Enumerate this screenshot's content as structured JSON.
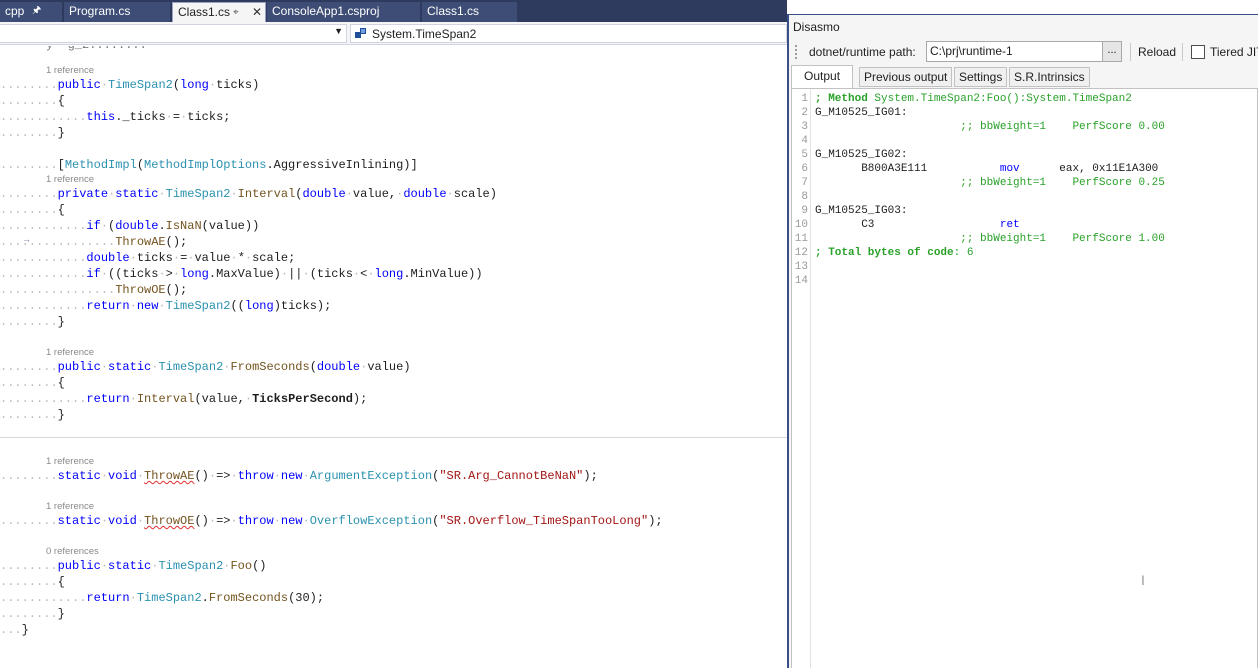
{
  "tabs": [
    {
      "label": "cpp",
      "pinned": true,
      "active": false
    },
    {
      "label": "Program.cs",
      "active": false
    },
    {
      "label": "Class1.cs",
      "pinned": true,
      "active": true,
      "close": "✕"
    },
    {
      "label": "ConsoleApp1.csproj",
      "active": false
    },
    {
      "label": "Class1.cs",
      "active": false
    }
  ],
  "navbar": {
    "left_value": "",
    "right_value": "System.TimeSpan2"
  },
  "editor": {
    "refs": {
      "r1": "1 reference",
      "r2": "1 reference",
      "r3": "1 reference",
      "r4": "1 reference",
      "r5": "1 reference",
      "r6": "0 references"
    },
    "code": {
      "l01a": "public",
      "l01b": "TimeSpan2",
      "l01c": "(",
      "l01d": "long",
      "l01e": "ticks",
      "l01f": ")",
      "l02": "{",
      "l03a": "this",
      "l03b": "._ticks",
      "l03c": "=",
      "l03d": "ticks;",
      "l04": "}",
      "l05a": "[",
      "l05b": "MethodImpl",
      "l05c": "(",
      "l05d": "MethodImplOptions",
      "l05e": ".AggressiveInlining)]",
      "l06a": "private",
      "l06b": "static",
      "l06c": "TimeSpan2",
      "l06d": "Interval",
      "l06e": "(",
      "l06f": "double",
      "l06g": "value,",
      "l06h": "double",
      "l06i": "scale)",
      "l07": "{",
      "l08a": "if",
      "l08b": "(",
      "l08c": "double",
      "l08d": ".",
      "l08e": "IsNaN",
      "l08f": "(value))",
      "l09a": "ThrowAE",
      "l09b": "();",
      "l10a": "double",
      "l10b": "ticks",
      "l10c": "=",
      "l10d": "value",
      "l10e": "*",
      "l10f": "scale;",
      "l11a": "if",
      "l11b": "((ticks",
      "l11c": ">",
      "l11d": "long",
      "l11e": ".MaxValue)",
      "l11f": "||",
      "l11g": "(ticks",
      "l11h": "<",
      "l11i": "long",
      "l11j": ".MinValue))",
      "l12a": "ThrowOE",
      "l12b": "();",
      "l13a": "return",
      "l13b": "new",
      "l13c": "TimeSpan2",
      "l13d": "((",
      "l13e": "long",
      "l13f": ")ticks);",
      "l14": "}",
      "l15a": "public",
      "l15b": "static",
      "l15c": "TimeSpan2",
      "l15d": "FromSeconds",
      "l15e": "(",
      "l15f": "double",
      "l15g": "value)",
      "l16": "{",
      "l17a": "return",
      "l17b": "Interval",
      "l17c": "(value,",
      "l17d": "TicksPerSecond",
      "l17e": ");",
      "l18": "}",
      "l19a": "static",
      "l19b": "void",
      "l19c": "ThrowAE",
      "l19d": "()",
      "l19e": "=>",
      "l19f": "throw",
      "l19g": "new",
      "l19h": "ArgumentException",
      "l19i": "(",
      "l19j": "\"SR.Arg_CannotBeNaN\"",
      "l19k": ");",
      "l20a": "static",
      "l20b": "void",
      "l20c": "ThrowOE",
      "l20d": "()",
      "l20e": "=>",
      "l20f": "throw",
      "l20g": "new",
      "l20h": "OverflowException",
      "l20i": "(",
      "l20j": "\"SR.Overflow_TimeSpanTooLong\"",
      "l20k": ");",
      "l21a": "public",
      "l21b": "static",
      "l21c": "TimeSpan2",
      "l21d": "Foo",
      "l21e": "()",
      "l22": "{",
      "l23a": "return",
      "l23b": "TimeSpan2",
      "l23c": ".",
      "l23d": "FromSeconds",
      "l23e": "(30);",
      "l24": "}",
      "l25": "}"
    }
  },
  "toolwindow": {
    "title": "Disasmo",
    "path_label": "dotnet/runtime path:",
    "path_value": "C:\\prj\\runtime-1",
    "browse_label": "...",
    "reload_label": "Reload",
    "tiered_label": "Tiered JIT",
    "tiered_checked": false,
    "tabs": [
      "Output",
      "Previous output",
      "Settings",
      "S.R.Intrinsics"
    ],
    "selected_tab": "Output",
    "line_numbers": [
      "1",
      "2",
      "3",
      "4",
      "5",
      "6",
      "7",
      "8",
      "9",
      "10",
      "11",
      "12",
      "13",
      "14"
    ],
    "asm": {
      "l1a": "; Method",
      "l1b": " System.TimeSpan2:Foo():System.TimeSpan2",
      "l2": "G_M10525_IG01:",
      "l3": "                      ;; bbWeight=1    PerfScore 0.00",
      "l5": "G_M10525_IG02:",
      "l6a": "       B800A3E111           ",
      "l6b": "mov",
      "l6c": "      eax, 0x11E1A300",
      "l7": "                      ;; bbWeight=1    PerfScore 0.25",
      "l9": "G_M10525_IG03:",
      "l10a": "       C3                   ",
      "l10b": "ret",
      "l11": "                      ;; bbWeight=1    PerfScore 1.00",
      "l12a": "; Total bytes of code",
      "l12b": ": 6"
    }
  },
  "colors": {
    "tabstrip": "#2f3b5e",
    "keyword": "#0000ff",
    "type": "#2b91af",
    "method": "#74531f",
    "string": "#a31515",
    "comment": "#2aa12a"
  }
}
